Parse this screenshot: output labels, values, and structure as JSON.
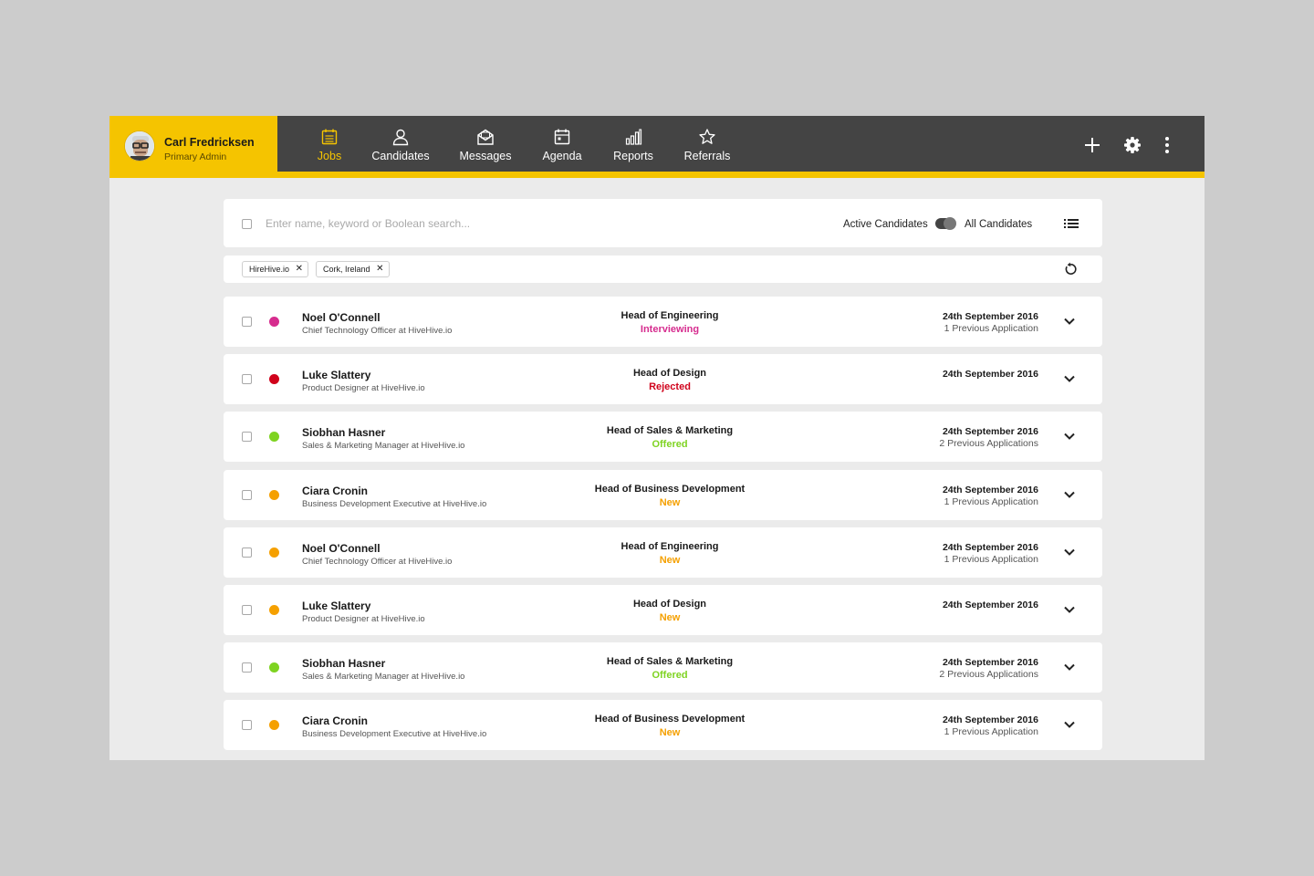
{
  "user": {
    "name": "Carl Fredricksen",
    "role": "Primary Admin"
  },
  "nav": [
    {
      "label": "Jobs",
      "icon": "calendar-list-icon",
      "active": true
    },
    {
      "label": "Candidates",
      "icon": "person-icon",
      "active": false
    },
    {
      "label": "Messages",
      "icon": "envelope-icon",
      "active": false
    },
    {
      "label": "Agenda",
      "icon": "calendar-icon",
      "active": false
    },
    {
      "label": "Reports",
      "icon": "bar-chart-icon",
      "active": false
    },
    {
      "label": "Referrals",
      "icon": "star-icon",
      "active": false
    }
  ],
  "header_actions": [
    {
      "icon": "plus-icon"
    },
    {
      "icon": "gear-icon"
    },
    {
      "icon": "more-vertical-icon"
    }
  ],
  "search": {
    "placeholder": "Enter name, keyword or Boolean search...",
    "value": "",
    "toggle_left": "Active Candidates",
    "toggle_right": "All Candidates"
  },
  "filters": [
    {
      "label": "HireHive.io"
    },
    {
      "label": "Cork, Ireland"
    }
  ],
  "colors": {
    "accent": "#f5c400",
    "header": "#444444",
    "interviewing": "#d62c8e",
    "rejected": "#d0021b",
    "offered": "#7ed321",
    "new": "#f5a000"
  },
  "candidates": [
    {
      "name": "Noel O'Connell",
      "title": "Chief Technology Officer at HiveHive.io",
      "job": "Head of Engineering",
      "status": "Interviewing",
      "status_color": "#d62c8e",
      "date": "24th September 2016",
      "previous": "1 Previous Application"
    },
    {
      "name": "Luke Slattery",
      "title": "Product Designer at HiveHive.io",
      "job": "Head of Design",
      "status": "Rejected",
      "status_color": "#d0021b",
      "date": "24th September 2016",
      "previous": ""
    },
    {
      "name": "Siobhan Hasner",
      "title": "Sales & Marketing Manager at HiveHive.io",
      "job": "Head of Sales & Marketing",
      "status": "Offered",
      "status_color": "#7ed321",
      "date": "24th September 2016",
      "previous": "2 Previous Applications"
    },
    {
      "name": "Ciara Cronin",
      "title": "Business Development Executive at HiveHive.io",
      "job": "Head of Business Development",
      "status": "New",
      "status_color": "#f5a000",
      "date": "24th September 2016",
      "previous": "1 Previous Application"
    },
    {
      "name": "Noel O'Connell",
      "title": "Chief Technology Officer at HiveHive.io",
      "job": "Head of Engineering",
      "status": "New",
      "status_color": "#f5a000",
      "date": "24th September 2016",
      "previous": "1 Previous Application"
    },
    {
      "name": "Luke Slattery",
      "title": "Product Designer at HiveHive.io",
      "job": "Head of Design",
      "status": "New",
      "status_color": "#f5a000",
      "date": "24th September 2016",
      "previous": ""
    },
    {
      "name": "Siobhan Hasner",
      "title": "Sales & Marketing Manager at HiveHive.io",
      "job": "Head of Sales & Marketing",
      "status": "Offered",
      "status_color": "#7ed321",
      "date": "24th September 2016",
      "previous": "2 Previous Applications"
    },
    {
      "name": "Ciara Cronin",
      "title": "Business Development Executive at HiveHive.io",
      "job": "Head of Business Development",
      "status": "New",
      "status_color": "#f5a000",
      "date": "24th September 2016",
      "previous": "1 Previous Application"
    }
  ]
}
